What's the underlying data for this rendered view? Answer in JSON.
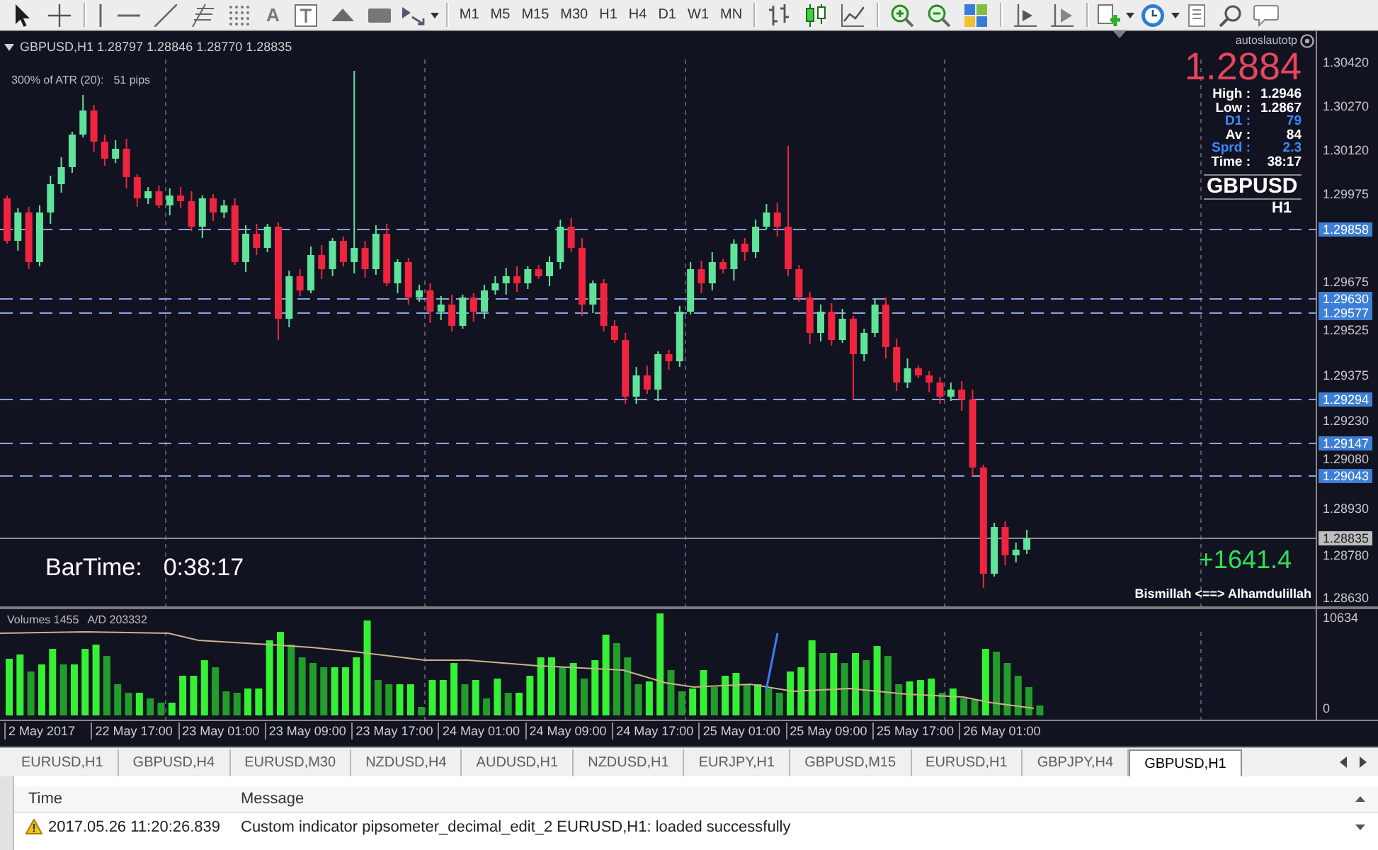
{
  "toolbar": {
    "text_tool": "A",
    "timeframes": [
      "M1",
      "M5",
      "M15",
      "M30",
      "H1",
      "H4",
      "D1",
      "W1",
      "MN"
    ]
  },
  "chart": {
    "header": "GBPUSD,H1 1.28797 1.28846 1.28770 1.28835",
    "atr_label": "300% of ATR (20):",
    "atr_value": "51 pips",
    "info_panel": {
      "author": "autoslautotp",
      "price": "1.2884",
      "rows": [
        {
          "label": "High :",
          "value": "1.2946",
          "color": "#ffffff"
        },
        {
          "label": "Low :",
          "value": "1.2867",
          "color": "#ffffff"
        },
        {
          "label": "D1 :",
          "value": "79",
          "color": "#3d8bff"
        },
        {
          "label": "Av :",
          "value": "84",
          "color": "#ffffff"
        },
        {
          "label": "Sprd :",
          "value": "2.3",
          "color": "#3d8bff"
        },
        {
          "label": "Time :",
          "value": "38:17",
          "color": "#ffffff"
        }
      ],
      "symbol": "GBPUSD",
      "timeframe": "H1"
    },
    "bar_time": {
      "label": "BarTime:",
      "value": "0:38:17"
    },
    "profit": "+1641.4",
    "note": "Bismillah <==> Alhamdulillah",
    "price_axis": [
      {
        "text": "1.30420",
        "kind": "tick"
      },
      {
        "text": "1.30270",
        "kind": "tick"
      },
      {
        "text": "1.30120",
        "kind": "tick"
      },
      {
        "text": "1.29975",
        "kind": "tick"
      },
      {
        "text": "1.29858",
        "kind": "level"
      },
      {
        "text": "1.29675",
        "kind": "tick"
      },
      {
        "text": "1.29630",
        "kind": "level"
      },
      {
        "text": "1.29577",
        "kind": "level"
      },
      {
        "text": "1.29525",
        "kind": "tick"
      },
      {
        "text": "1.29375",
        "kind": "tick"
      },
      {
        "text": "1.29294",
        "kind": "level"
      },
      {
        "text": "1.29230",
        "kind": "tick"
      },
      {
        "text": "1.29147",
        "kind": "level"
      },
      {
        "text": "1.29080",
        "kind": "tick"
      },
      {
        "text": "1.29043",
        "kind": "level"
      },
      {
        "text": "1.28930",
        "kind": "tick"
      },
      {
        "text": "1.28835",
        "kind": "bid"
      },
      {
        "text": "1.28780",
        "kind": "tick"
      },
      {
        "text": "1.28630",
        "kind": "tick"
      }
    ]
  },
  "indicator": {
    "volumes_label": "Volumes 1455",
    "ad_label": "A/D 203332",
    "axis": [
      "10634",
      "0"
    ]
  },
  "time_axis": [
    "2 May 2017",
    "22 May 17:00",
    "23 May 01:00",
    "23 May 09:00",
    "23 May 17:00",
    "24 May 01:00",
    "24 May 09:00",
    "24 May 17:00",
    "25 May 01:00",
    "25 May 09:00",
    "25 May 17:00",
    "26 May 01:00"
  ],
  "tabs": [
    {
      "label": "EURUSD,H1",
      "selected": false
    },
    {
      "label": "GBPUSD,H4",
      "selected": false
    },
    {
      "label": "EURUSD,M30",
      "selected": false
    },
    {
      "label": "NZDUSD,H4",
      "selected": false
    },
    {
      "label": "AUDUSD,H1",
      "selected": false
    },
    {
      "label": "NZDUSD,H1",
      "selected": false
    },
    {
      "label": "EURJPY,H1",
      "selected": false
    },
    {
      "label": "GBPUSD,M15",
      "selected": false
    },
    {
      "label": "EURUSD,H1",
      "selected": false
    },
    {
      "label": "GBPJPY,H4",
      "selected": false
    },
    {
      "label": "GBPUSD,H1",
      "selected": true
    }
  ],
  "journal": {
    "columns": [
      "Time",
      "Message"
    ],
    "rows": [
      {
        "time": "2017.05.26 11:20:26.839",
        "message": "Custom indicator pipsometer_decimal_edit_2 EURUSD,H1: loaded successfully"
      }
    ]
  }
}
